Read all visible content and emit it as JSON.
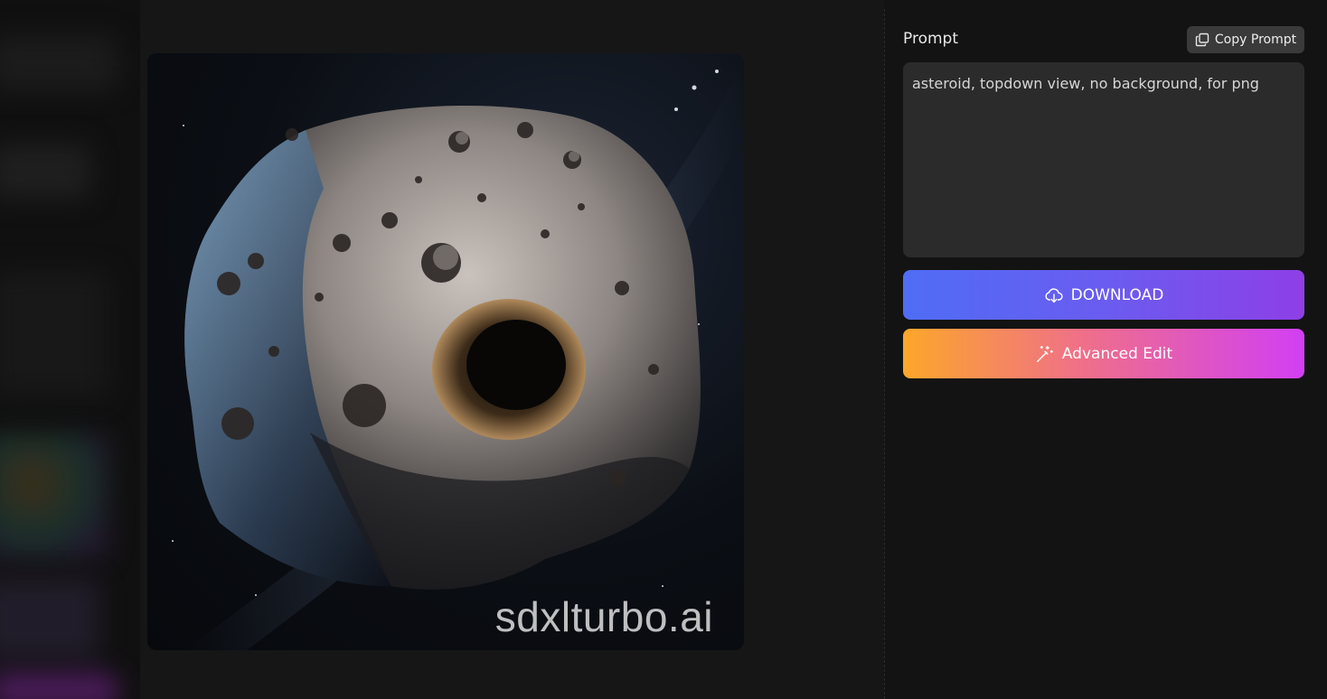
{
  "prompt_panel": {
    "label": "Prompt",
    "copy_button_label": "Copy Prompt",
    "prompt_text": "asteroid, topdown view, no background, for png"
  },
  "actions": {
    "download_label": "DOWNLOAD",
    "advanced_edit_label": "Advanced Edit"
  },
  "image": {
    "watermark": "sdxlturbo.ai"
  },
  "icons": {
    "copy": "copy-icon",
    "download": "cloud-download-icon",
    "advanced_edit": "magic-wand-icon"
  },
  "colors": {
    "download_gradient": [
      "#4f6df5",
      "#8d3fe6"
    ],
    "advanced_gradient": [
      "#fca72a",
      "#d13ff4"
    ],
    "panel_bg": "#131313",
    "prompt_box_bg": "#2b2b2b"
  }
}
